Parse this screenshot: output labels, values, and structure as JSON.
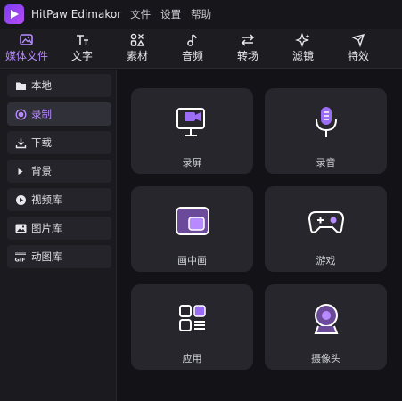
{
  "titlebar": {
    "app_name": "HitPaw Edimakor",
    "menu": [
      "文件",
      "设置",
      "帮助"
    ]
  },
  "tabs": [
    {
      "label": "媒体文件",
      "icon": "media-files-icon",
      "active": true
    },
    {
      "label": "文字",
      "icon": "text-icon",
      "active": false
    },
    {
      "label": "素材",
      "icon": "materials-icon",
      "active": false
    },
    {
      "label": "音频",
      "icon": "audio-icon",
      "active": false
    },
    {
      "label": "转场",
      "icon": "transition-icon",
      "active": false
    },
    {
      "label": "滤镜",
      "icon": "filter-icon",
      "active": false
    },
    {
      "label": "特效",
      "icon": "effects-icon",
      "active": false
    }
  ],
  "sidebar": {
    "items": [
      {
        "label": "本地",
        "icon": "folder-icon",
        "active": false
      },
      {
        "label": "录制",
        "icon": "record-icon",
        "active": true
      },
      {
        "label": "下载",
        "icon": "download-icon",
        "active": false
      },
      {
        "label": "背景",
        "icon": "triangle-right-icon",
        "active": false
      },
      {
        "label": "视频库",
        "icon": "video-library-icon",
        "active": false
      },
      {
        "label": "图片库",
        "icon": "image-library-icon",
        "active": false
      },
      {
        "label": "动图库",
        "icon": "gif-icon",
        "active": false
      }
    ]
  },
  "cards": [
    {
      "label": "录屏",
      "icon": "screen-record-icon"
    },
    {
      "label": "录音",
      "icon": "microphone-icon"
    },
    {
      "label": "画中画",
      "icon": "picture-in-picture-icon"
    },
    {
      "label": "游戏",
      "icon": "gamepad-icon"
    },
    {
      "label": "应用",
      "icon": "apps-icon"
    },
    {
      "label": "摄像头",
      "icon": "webcam-icon"
    }
  ],
  "colors": {
    "accent": "#b78bff",
    "accent_fill": "#9b6cf5",
    "background": "#131317",
    "card": "#26262c"
  }
}
